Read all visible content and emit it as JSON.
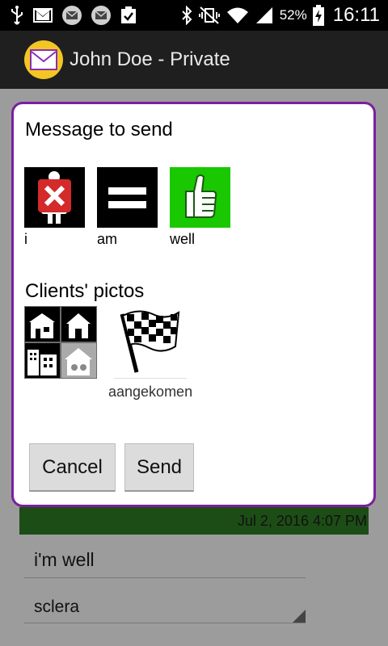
{
  "status_bar": {
    "battery_percent": "52%",
    "time": "16:11",
    "icons": [
      "usb-icon",
      "gmail-icon",
      "mail-icon",
      "mail-icon",
      "clipboard-check-icon",
      "bluetooth-icon",
      "vibrate-mute-icon",
      "wifi-icon",
      "signal-icon",
      "battery-charging-icon"
    ]
  },
  "action_bar": {
    "title": "John Doe - Private",
    "icon": "envelope-icon"
  },
  "background": {
    "date": "Jul 2, 2016 4:07 PM",
    "message_text": "i'm well",
    "picto_set": "sclera"
  },
  "dialog": {
    "title": "Message to send",
    "message_pictos": [
      {
        "label": "i",
        "icon": "person-cross-icon"
      },
      {
        "label": "am",
        "icon": "equals-icon"
      },
      {
        "label": "well",
        "icon": "thumbs-up-icon"
      }
    ],
    "clients_title": "Clients' pictos",
    "client_pictos": [
      {
        "label": "",
        "icon": "buildings-collage-icon"
      },
      {
        "label": "aangekomen",
        "icon": "checkered-flag-icon"
      }
    ],
    "cancel_label": "Cancel",
    "send_label": "Send"
  },
  "colors": {
    "dialog_border": "#7a1fa2",
    "well_picto_bg": "#19c800",
    "status_bar_bg": "#000000",
    "date_bar_bg": "#1d4d16",
    "app_icon_bg": "#f3c623"
  }
}
